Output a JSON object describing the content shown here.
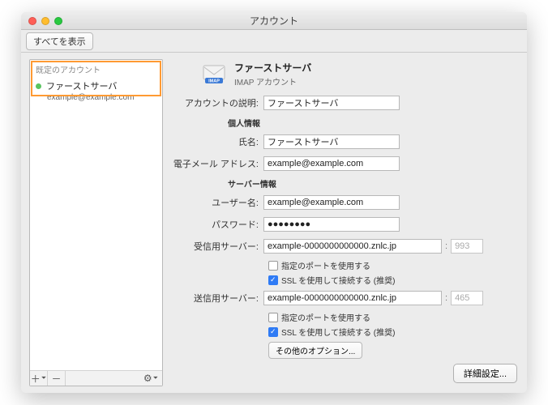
{
  "window": {
    "title": "アカウント"
  },
  "toolbar": {
    "show_all": "すべてを表示"
  },
  "sidebar": {
    "header": "既定のアカウント",
    "account": {
      "name": "ファーストサーバ",
      "email": "example@example.com"
    },
    "footer": {
      "add": "＋",
      "sep": "⎮",
      "remove": "－",
      "gear": "⚙",
      "drop": "⏷"
    }
  },
  "main": {
    "header": {
      "title": "ファーストサーバ",
      "subtitle": "IMAP アカウント"
    },
    "labels": {
      "desc": "アカウントの説明:",
      "personal": "個人情報",
      "name": "氏名:",
      "email": "電子メール アドレス:",
      "server_info": "サーバー情報",
      "user": "ユーザー名:",
      "pass": "パスワード:",
      "incoming": "受信用サーバー:",
      "outgoing": "送信用サーバー:",
      "default_port": "指定のポートを使用する",
      "ssl": "SSL を使用して接続する (推奨)",
      "more": "その他のオプション...",
      "advanced": "詳細設定..."
    },
    "values": {
      "desc": "ファーストサーバ",
      "name": "ファーストサーバ",
      "email": "example@example.com",
      "user": "example@example.com",
      "pass": "●●●●●●●●",
      "incoming_server": "example-0000000000000.znlc.jp",
      "incoming_port": "993",
      "outgoing_server": "example-0000000000000.znlc.jp",
      "outgoing_port": "465",
      "port_sep": ":"
    }
  }
}
